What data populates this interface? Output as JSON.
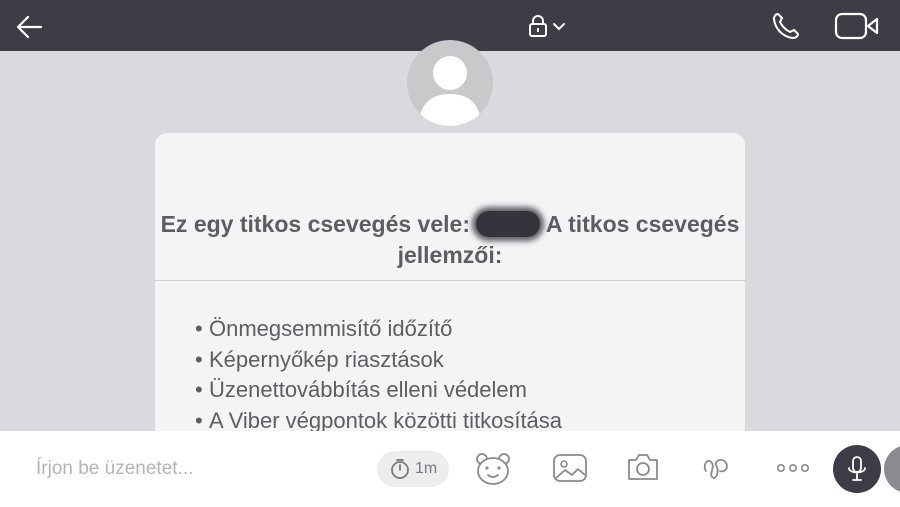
{
  "header": {
    "back_icon": "arrow-left-icon",
    "lock_icon": "lock-icon",
    "dropdown_icon": "chevron-down-icon",
    "call_icon": "phone-icon",
    "video_icon": "video-camera-icon"
  },
  "secret_chat": {
    "title_before": "Ez egy titkos csevegés vele:",
    "title_after": "A titkos csevegés jellemzői:",
    "features": [
      "Önmegsemmisítő időzítő",
      "Képernyőkép riasztások",
      "Üzenettovábbítás elleni védelem",
      "A Viber végpontok közötti titkosítása"
    ]
  },
  "composer": {
    "placeholder": "Írjon be üzenetet...",
    "timer_label": "1m",
    "timer_icon": "stopwatch-icon",
    "sticker_icon": "sticker-bear-icon",
    "gallery_icon": "image-icon",
    "camera_icon": "camera-icon",
    "doodle_icon": "doodle-icon",
    "more_icon": "more-dots-icon",
    "mic_icon": "microphone-icon"
  },
  "colors": {
    "header_bg": "#3c3d46",
    "chat_bg": "#d9dadd",
    "card_bg": "#f4f4f5",
    "text": "#5d5d63"
  }
}
